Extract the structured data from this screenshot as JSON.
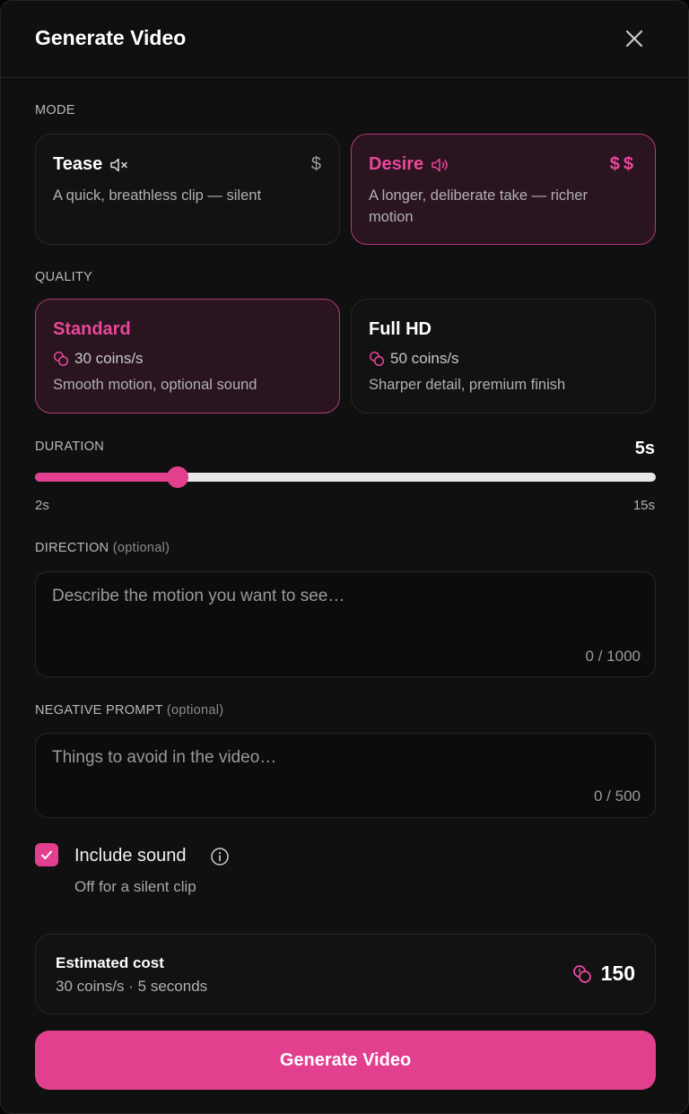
{
  "dialog": {
    "title": "Generate Video"
  },
  "mode": {
    "label": "MODE",
    "options": [
      {
        "name": "Tease",
        "description": "A quick, breathless clip — silent",
        "price": "$",
        "sound_icon": "speaker-muted-icon",
        "selected": false
      },
      {
        "name": "Desire",
        "description_line1": "A longer, deliberate take — richer",
        "description_line2": "motion",
        "price": "$$",
        "sound_icon": "speaker-on-icon",
        "selected": true
      }
    ]
  },
  "quality": {
    "label": "QUALITY",
    "options": [
      {
        "name": "Standard",
        "rate": "30 coins/s",
        "description": "Smooth motion, optional sound",
        "selected": true
      },
      {
        "name": "Full HD",
        "rate": "50 coins/s",
        "description": "Sharper detail, premium finish",
        "selected": false
      }
    ]
  },
  "duration": {
    "label": "DURATION",
    "value_text": "5s",
    "min_label": "2s",
    "max_label": "15s",
    "value": 5,
    "min": 2,
    "max": 15
  },
  "direction": {
    "label": "DIRECTION",
    "optional": "(optional)",
    "placeholder": "Describe the motion you want to see…",
    "counter": "0 / 1000"
  },
  "negative_prompt": {
    "label": "NEGATIVE PROMPT",
    "optional": "(optional)",
    "placeholder": "Things to avoid in the video…",
    "counter": "0 / 500"
  },
  "sound": {
    "label": "Include sound",
    "hint": "Off for a silent clip",
    "checked": true
  },
  "cost": {
    "title": "Estimated cost",
    "breakdown": "30 coins/s · 5 seconds",
    "total": "150"
  },
  "actions": {
    "generate_label": "Generate Video"
  },
  "colors": {
    "accent": "#e23f8e",
    "selected_bg": "#2a1420",
    "panel": "#101010"
  }
}
